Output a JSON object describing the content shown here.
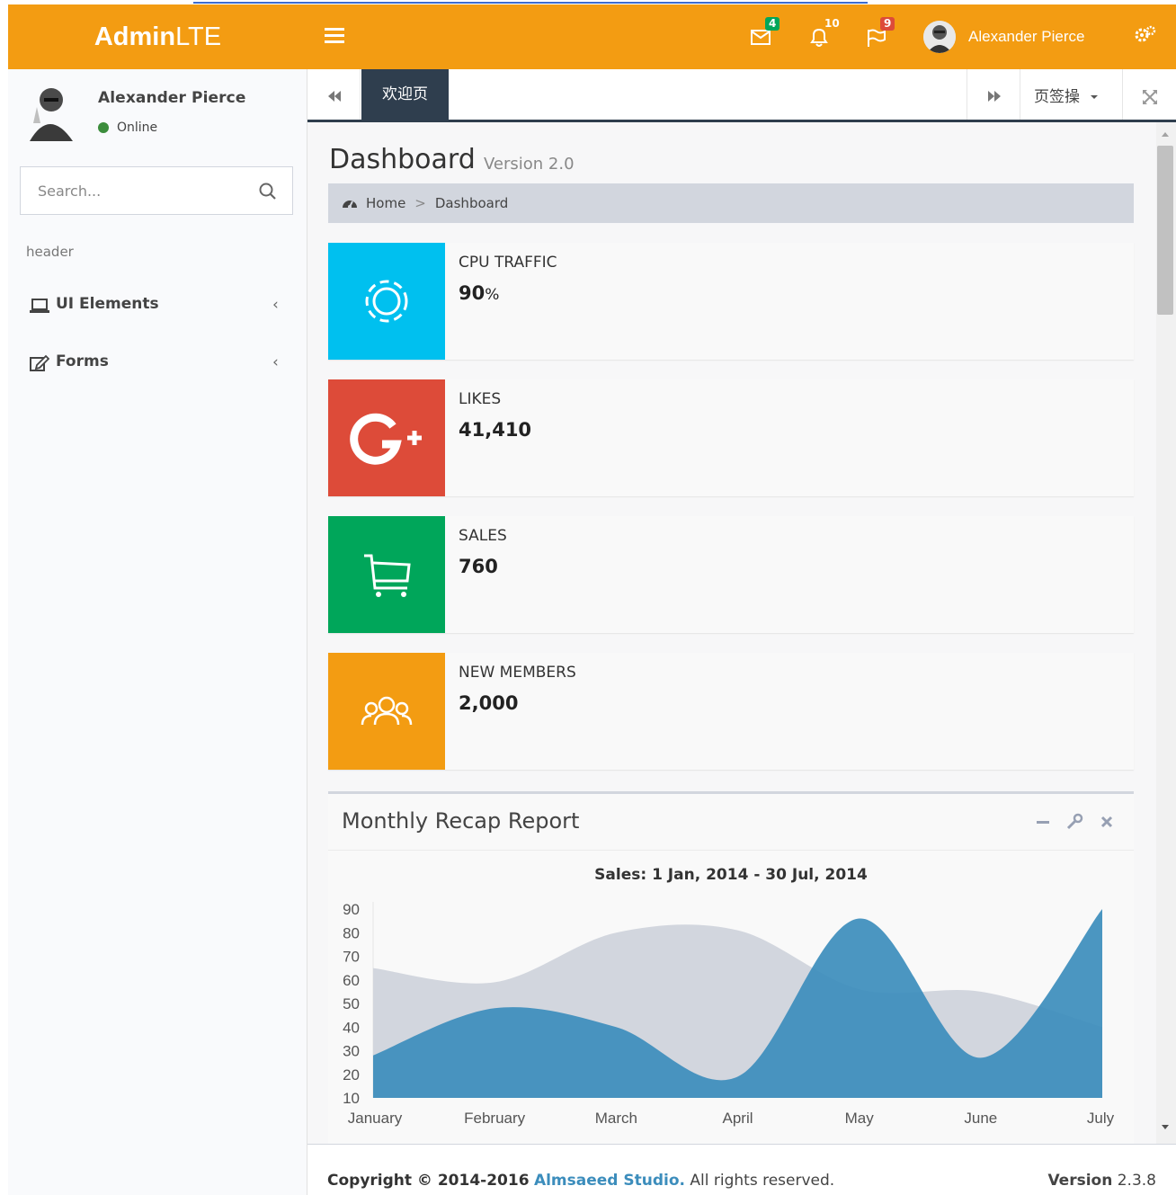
{
  "header": {
    "logo_bold": "Admin",
    "logo_light": "LTE",
    "messages_count": "4",
    "notifications_count": "10",
    "tasks_count": "9",
    "user_name": "Alexander Pierce",
    "colors": {
      "header": "#f39c12",
      "msg_badge": "#00a65a",
      "task_badge": "#dd4b39"
    }
  },
  "sidebar": {
    "user_name": "Alexander Pierce",
    "status": "Online",
    "search_placeholder": "Search...",
    "menu_header": "header",
    "items": [
      {
        "label": "UI Elements",
        "icon": "laptop-icon"
      },
      {
        "label": "Forms",
        "icon": "edit-icon"
      }
    ]
  },
  "tabs": {
    "active_label": "欢迎页",
    "ops_label": "页签操"
  },
  "content": {
    "title": "Dashboard",
    "subtitle": "Version 2.0",
    "breadcrumb": {
      "home": "Home",
      "current": "Dashboard"
    },
    "info_boxes": [
      {
        "label": "CPU TRAFFIC",
        "value": "90",
        "unit": "%",
        "color": "#00c0ef",
        "icon": "gear-icon"
      },
      {
        "label": "LIKES",
        "value": "41,410",
        "unit": "",
        "color": "#dd4b39",
        "icon": "google-plus-icon"
      },
      {
        "label": "SALES",
        "value": "760",
        "unit": "",
        "color": "#00a65a",
        "icon": "shopping-cart-icon"
      },
      {
        "label": "NEW MEMBERS",
        "value": "2,000",
        "unit": "",
        "color": "#f39c12",
        "icon": "users-icon"
      }
    ],
    "report": {
      "title": "Monthly Recap Report",
      "chart_title": "Sales: 1 Jan, 2014 - 30 Jul, 2014"
    }
  },
  "chart_data": {
    "type": "area",
    "title": "Sales: 1 Jan, 2014 - 30 Jul, 2014",
    "categories": [
      "January",
      "February",
      "March",
      "April",
      "May",
      "June",
      "July"
    ],
    "ylim": [
      10,
      90
    ],
    "yticks": [
      90,
      80,
      70,
      60,
      50,
      40,
      30,
      20,
      10
    ],
    "series": [
      {
        "values": [
          65,
          59,
          80,
          81,
          56,
          55,
          40
        ],
        "color": "#d2d6de"
      },
      {
        "values": [
          28,
          48,
          40,
          19,
          86,
          27,
          90
        ],
        "color": "#3c8dbc"
      }
    ],
    "grid": false
  },
  "footer": {
    "copyright": "Copyright © 2014-2016",
    "studio": "Almsaeed Studio.",
    "rights": "All rights reserved.",
    "version_label": "Version",
    "version": "2.3.8"
  }
}
